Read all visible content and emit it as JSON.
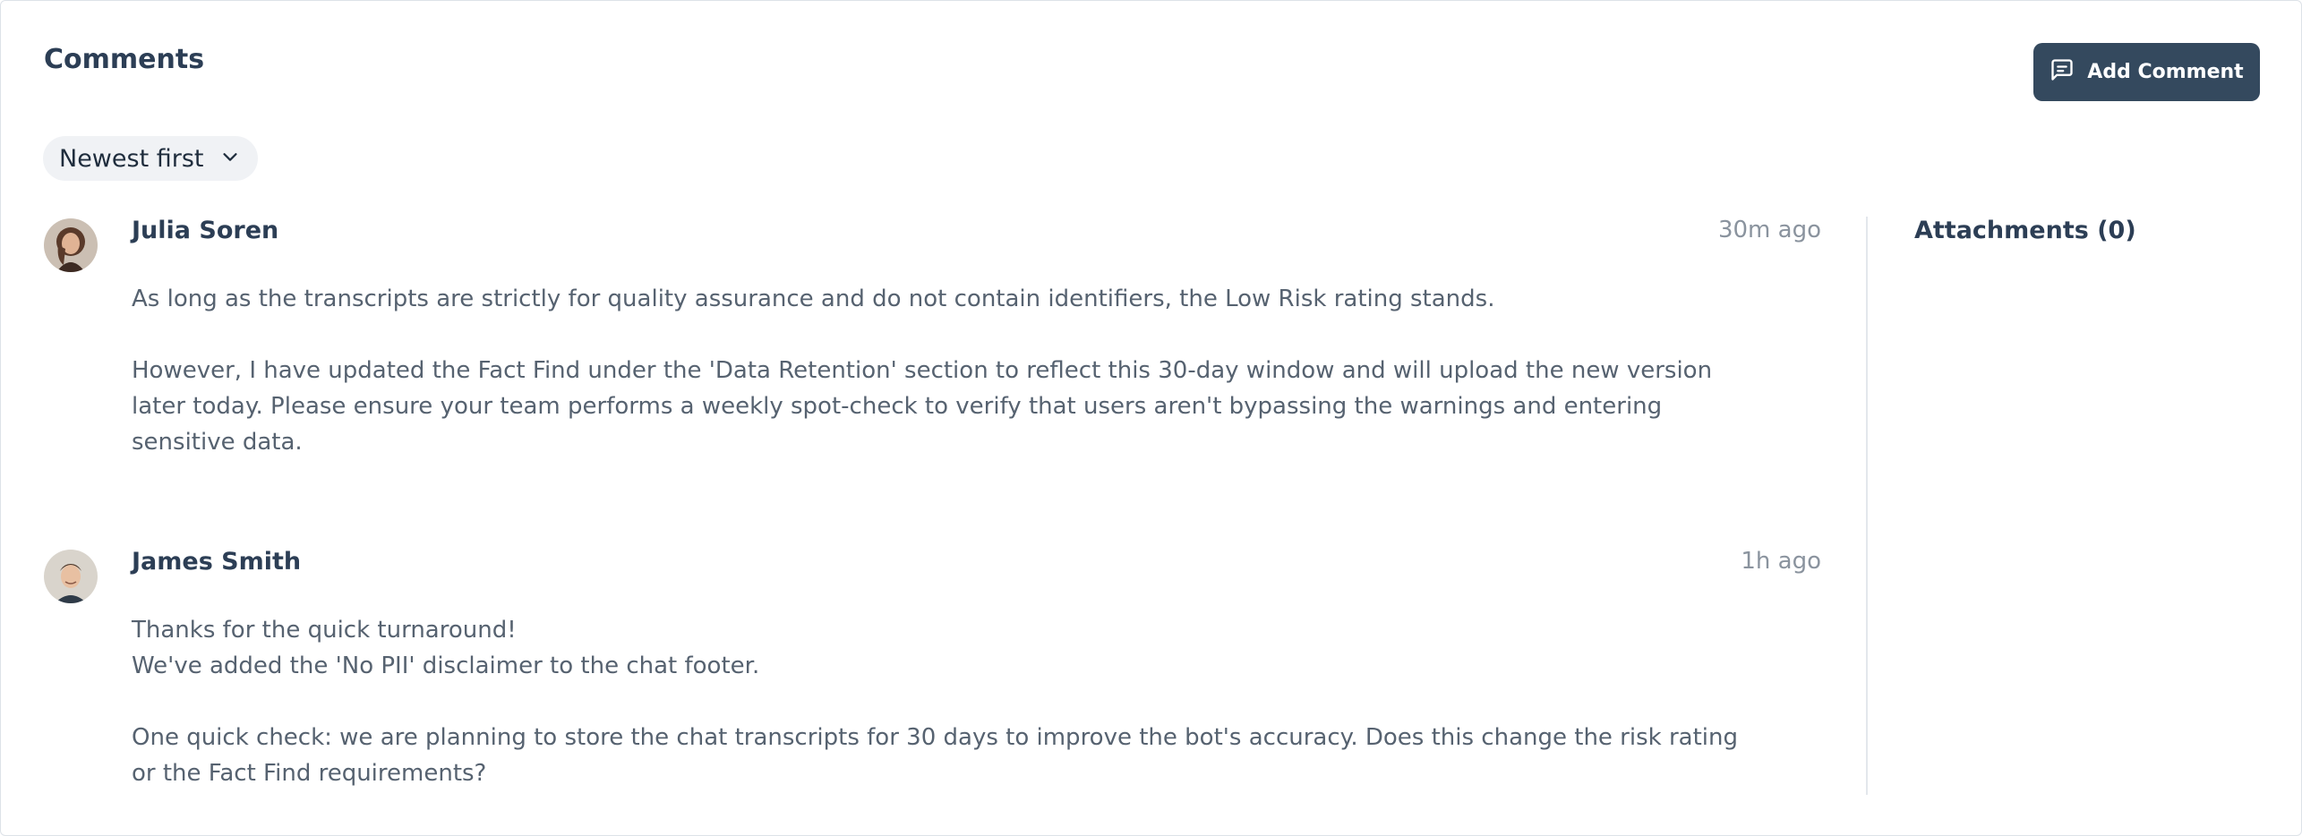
{
  "panel": {
    "title": "Comments"
  },
  "toolbar": {
    "add_comment_label": "Add Comment",
    "add_comment_icon": "message-square-icon"
  },
  "sort": {
    "selected": "Newest first",
    "icon": "chevron-down-icon"
  },
  "comments": [
    {
      "author": "Julia Soren",
      "time": "30m ago",
      "paragraphs": [
        "As long as the transcripts are strictly for quality assurance and do not contain identifiers, the Low Risk rating stands.",
        "However, I have updated the Fact Find under the 'Data Retention' section to reflect this 30-day window and will upload the new version later today. Please ensure your team performs a weekly spot-check to verify that users aren't bypassing the warnings and entering sensitive data."
      ]
    },
    {
      "author": "James Smith",
      "time": "1h ago",
      "paragraphs": [
        "Thanks for the quick turnaround!",
        "We've added the 'No PII' disclaimer to the chat footer.",
        "One quick check: we are planning to store the chat transcripts for 30 days to improve the bot's accuracy. Does this change the risk rating or the Fact Find requirements?"
      ]
    }
  ],
  "sidebar": {
    "attachments_label": "Attachments (0)"
  },
  "colors": {
    "accent": "#34495e",
    "heading": "#2c3e55",
    "muted": "#8a939e",
    "body_text": "#566270"
  }
}
